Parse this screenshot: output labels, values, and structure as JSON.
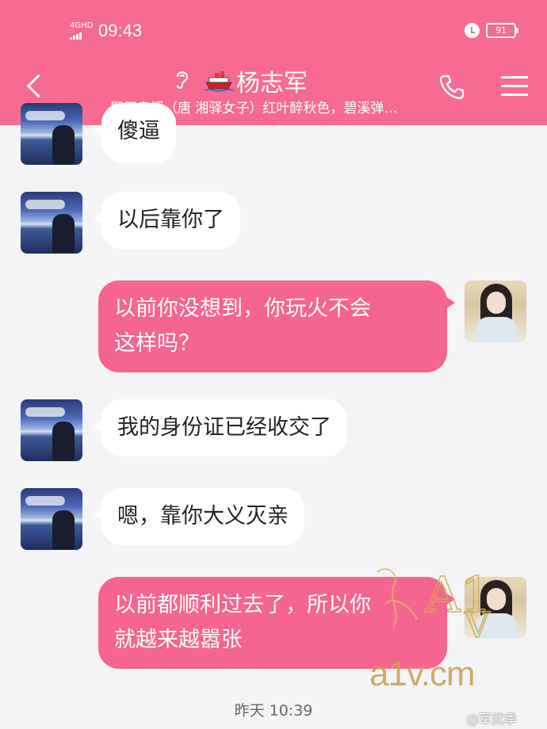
{
  "status_bar": {
    "network": "4GHD",
    "time": "09:43",
    "battery": "91"
  },
  "header": {
    "contact_name": "杨志军",
    "signature": "题玉泉溪（唐 湘驿女子）红叶醉秋色，碧溪弹…",
    "icons": [
      "back-icon",
      "ear-icon",
      "ship-icon",
      "phone-icon",
      "menu-icon"
    ]
  },
  "messages": [
    {
      "side": "left",
      "text": "傻逼"
    },
    {
      "side": "left",
      "text": "以后靠你了"
    },
    {
      "side": "right",
      "lines": [
        "以前你没想到，你玩火不会",
        "这样吗？"
      ]
    },
    {
      "side": "left",
      "text": "我的身份证已经收交了"
    },
    {
      "side": "left",
      "text": "嗯，靠你大义灭亲"
    },
    {
      "side": "right",
      "lines": [
        "以前都顺利过去了，所以你",
        "就越来越嚣张"
      ]
    }
  ],
  "timestamp": "昨天 10:39",
  "watermark": {
    "logo_text": "A1V",
    "url": "a1v.cm"
  },
  "weibo_watermark": "@军武季",
  "colors": {
    "header": "#f76a92",
    "bubble_right": "#f6658f",
    "bubble_left": "#ffffff",
    "background": "#f4f4f6"
  }
}
